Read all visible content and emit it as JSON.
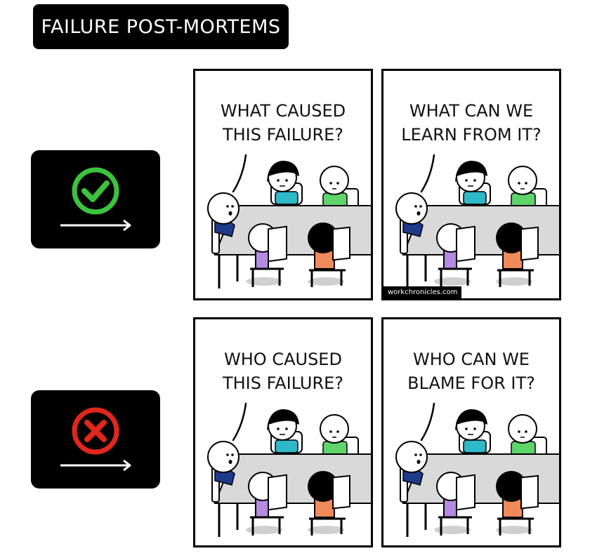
{
  "title": "FAILURE POST-MORTEMS",
  "rows": [
    {
      "status": "check",
      "status_color": "#3cc33c",
      "panels": [
        {
          "lines": [
            "WHAT CAUSED",
            "THIS FAILURE?"
          ]
        },
        {
          "lines": [
            "WHAT CAN WE",
            "LEARN FROM IT?"
          ]
        }
      ]
    },
    {
      "status": "cross",
      "status_color": "#e1261c",
      "panels": [
        {
          "lines": [
            "WHO CAUSED",
            "THIS FAILURE?"
          ]
        },
        {
          "lines": [
            "WHO CAN WE",
            "BLAME FOR IT?"
          ]
        }
      ]
    }
  ],
  "credit": "workchronicles.com",
  "colors": {
    "shirt_left": "#2fb8c8",
    "shirt_right": "#5ed46a",
    "suit": "#1e3a8a",
    "chair_purple": "#b48be0",
    "chair_orange": "#f08a5a",
    "table": "#d9d9d9"
  }
}
